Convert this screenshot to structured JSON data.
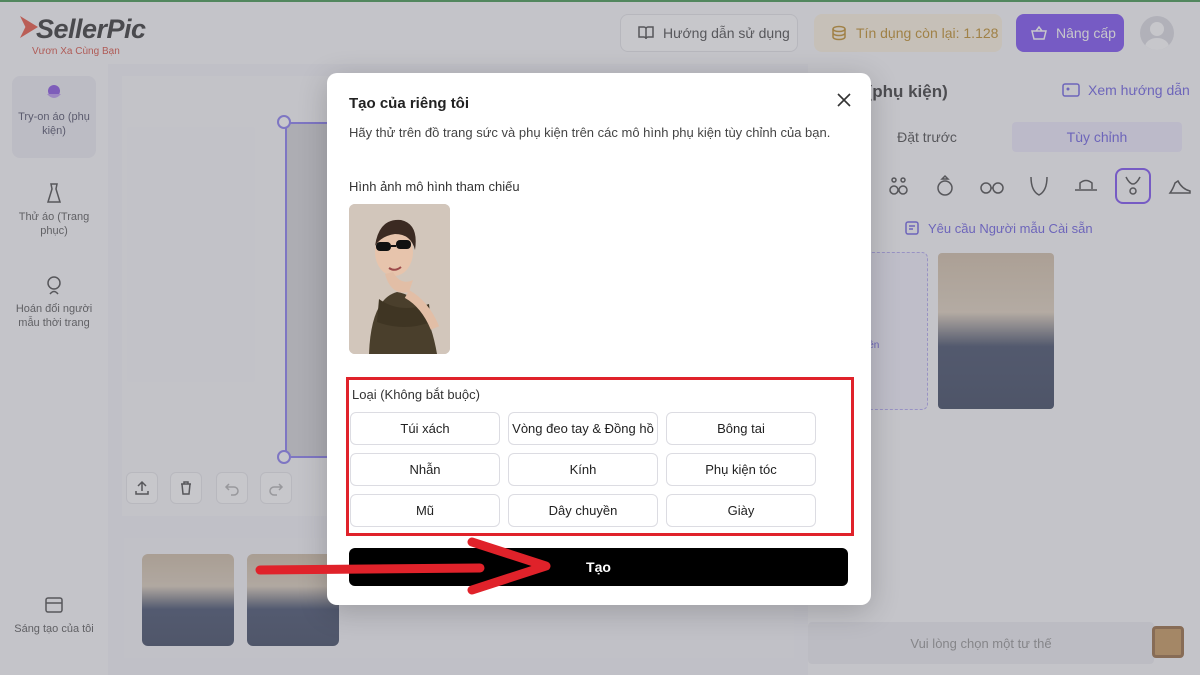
{
  "header": {
    "logo_text": "SellerPic",
    "logo_tagline": "Vươn Xa Cùng Bạn",
    "guide_label": "Hướng dẫn sử dụng",
    "credits_label": "Tín dụng còn lại: 1.128",
    "upgrade_label": "Nâng cấp"
  },
  "sidebar": {
    "items": [
      {
        "label": "Try-on áo (phụ kiện)",
        "icon": "tryon-accessory-icon"
      },
      {
        "label": "Thử áo (Trang phục)",
        "icon": "dress-icon"
      },
      {
        "label": "Hoán đổi người mẫu thời trang",
        "icon": "face-swap-icon"
      },
      {
        "label": "Sáng tạo của tôi",
        "icon": "folder-icon"
      }
    ]
  },
  "right_panel": {
    "title": "áo (phụ kiện)",
    "guide_label": "Xem hướng dẫn",
    "tabs": [
      "Đặt trước",
      "Tùy chỉnh"
    ],
    "active_tab": "Tùy chỉnh",
    "request_label": "Yêu cầu Người mẫu Cài sẵn",
    "upload_label": "lên",
    "bottom_hint": "Vui lòng chọn một tư thế"
  },
  "modal": {
    "title": "Tạo của riêng tôi",
    "subtitle": "Hãy thử trên đồ trang sức và phụ kiện trên các mô hình phụ kiện tùy chỉnh của bạn.",
    "reference_label": "Hình ảnh mô hình tham chiếu",
    "category_label": "Loại (Không bắt buộc)",
    "categories": [
      "Túi xách",
      "Vòng đeo tay & Đồng hồ",
      "Bông tai",
      "Nhẫn",
      "Kính",
      "Phụ kiện tóc",
      "Mũ",
      "Dây chuyền",
      "Giày"
    ],
    "create_label": "Tạo"
  },
  "colors": {
    "accent": "#6c3bf2",
    "annotation_red": "#e0222a",
    "create_button": "#000000"
  }
}
